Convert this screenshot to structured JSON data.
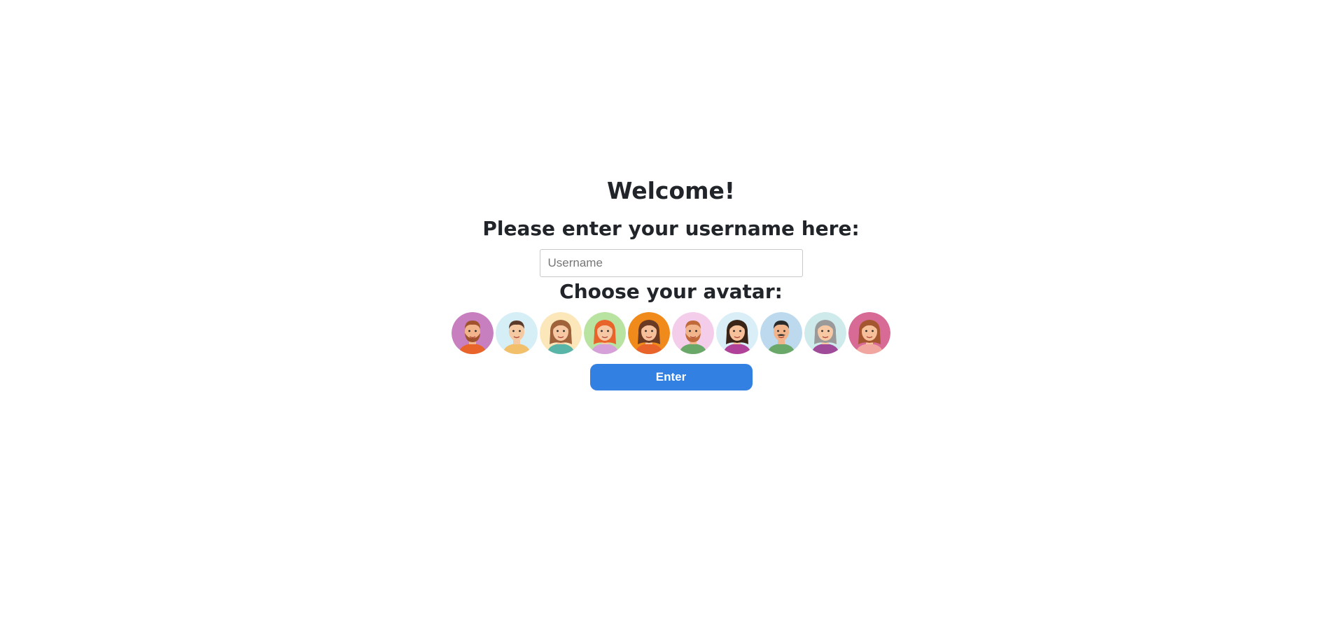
{
  "welcome_title": "Welcome!",
  "username_prompt": "Please enter your username here:",
  "username_input": {
    "placeholder": "Username",
    "value": ""
  },
  "avatar_prompt": "Choose your avatar:",
  "avatars": [
    {
      "name": "bearded-man-avatar",
      "bg": "#c77fbf",
      "skin": "#f2b48a",
      "hair": "#a0522d",
      "shirt": "#e8642a"
    },
    {
      "name": "smiling-man-avatar",
      "bg": "#d6eef5",
      "skin": "#f5c9a2",
      "hair": "#5a3b2a",
      "shirt": "#f2c06b"
    },
    {
      "name": "long-hair-woman-avatar",
      "bg": "#fbe7b9",
      "skin": "#f6c9a4",
      "hair": "#a0623a",
      "shirt": "#58b5a8"
    },
    {
      "name": "redhead-woman-avatar",
      "bg": "#b9e3a0",
      "skin": "#f6c9a4",
      "hair": "#e8642a",
      "shirt": "#d6a0d8"
    },
    {
      "name": "dark-hair-woman-avatar",
      "bg": "#f08a1a",
      "skin": "#f5c09a",
      "hair": "#6b3a22",
      "shirt": "#e8642a"
    },
    {
      "name": "ginger-bearded-man-avatar",
      "bg": "#f3cdea",
      "skin": "#f2b48a",
      "hair": "#c06a3a",
      "shirt": "#6aa86a"
    },
    {
      "name": "bob-hair-woman-avatar",
      "bg": "#d9eef6",
      "skin": "#f5c09a",
      "hair": "#3a2418",
      "shirt": "#b0429a"
    },
    {
      "name": "mustache-man-avatar",
      "bg": "#bcd9ee",
      "skin": "#f2b48a",
      "hair": "#2a2a2a",
      "shirt": "#6aa86a"
    },
    {
      "name": "grey-hair-woman-avatar",
      "bg": "#cfeaea",
      "skin": "#f6c9a4",
      "hair": "#9a9a9a",
      "shirt": "#a04a9a"
    },
    {
      "name": "auburn-woman-avatar",
      "bg": "#d86a96",
      "skin": "#f5c09a",
      "hair": "#a4562e",
      "shirt": "#f2a6a0"
    }
  ],
  "enter_button": {
    "label": "Enter",
    "color": "#3380e3"
  }
}
